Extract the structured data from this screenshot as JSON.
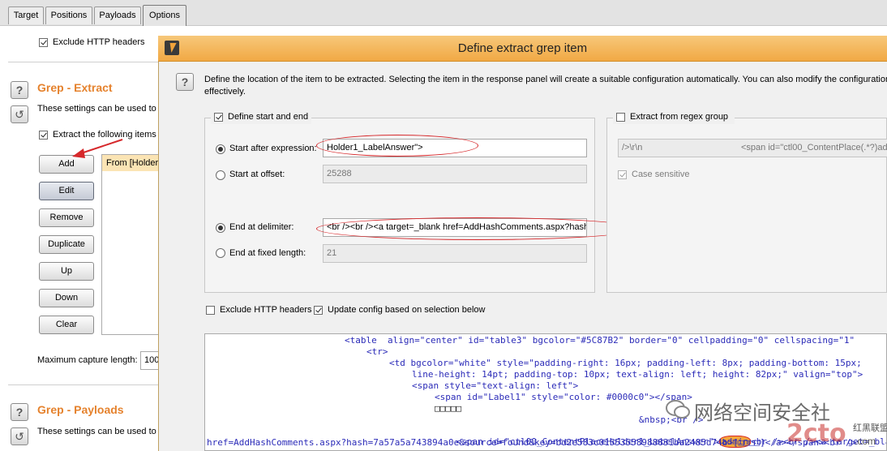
{
  "tabs": [
    {
      "label": "Target",
      "active": false
    },
    {
      "label": "Positions",
      "active": false
    },
    {
      "label": "Payloads",
      "active": false
    },
    {
      "label": "Options",
      "active": true
    }
  ],
  "left_panel": {
    "exclude_http_headers_label": "Exclude HTTP headers",
    "grep_extract": {
      "title": "Grep - Extract",
      "description": "These settings can be used to",
      "extract_following_label": "Extract the following items",
      "buttons": [
        "Add",
        "Edit",
        "Remove",
        "Duplicate",
        "Up",
        "Down",
        "Clear"
      ],
      "list_item": "From [Holder",
      "max_capture_label": "Maximum capture length:",
      "max_capture_value": "100"
    },
    "grep_payloads": {
      "title": "Grep - Payloads",
      "description": "These settings can be used to"
    }
  },
  "dialog": {
    "title": "Define extract grep item",
    "description": "Define the location of the item to be extracted. Selecting the item in the response panel will create a suitable configuration automatically. You can also modify the configuration m",
    "description_line2": "effectively.",
    "define_start_end_label": "Define start and end",
    "start_after_label": "Start after expression:",
    "start_after_value": "Holder1_LabelAnswer\">",
    "start_offset_label": "Start at offset:",
    "start_offset_value": "25288",
    "end_delimiter_label": "End at delimiter:",
    "end_delimiter_value": "<br /><br /><a target=_blank href=AddHashComments.aspx?hash",
    "end_fixed_label": "End at fixed length:",
    "end_fixed_value": "21",
    "regex_group_label": "Extract from regex group",
    "regex_value_left": "/>\\r\\n",
    "regex_value_right": "<span id=\"ctl00_ContentPlace(.*?)adm",
    "case_sensitive_label": "Case sensitive",
    "exclude_headers_label": "Exclude HTTP headers",
    "update_config_label": "Update config based on selection below"
  },
  "code_lines": [
    {
      "text": "<table  align=\"center\" id=\"table3\" bgcolor=\"#5C87B2\" border=\"0\" cellpadding=\"0\" cellspacing=\"1\""
    },
    {
      "text": "<tr>"
    },
    {
      "text": "<td bgcolor=\"white\" style=\"padding-right: 16px; padding-left: 8px; padding-bottom: 15px;"
    },
    {
      "text": "line-height: 14pt; padding-top: 10px; text-align: left; height: 82px;\" valign=\"top\">"
    },
    {
      "text": "<span style=\"text-align: left\">"
    },
    {
      "text": "<span id=\"Label1\" style=\"color: #0000c0\"></span>"
    },
    {
      "text": "□□□□□"
    },
    {
      "text": "&nbsp;<br />"
    },
    {
      "text": "<span id=\"ctl00_ContentPlaceHolder1_LabelAnswer\">"
    },
    {
      "text": "admin"
    },
    {
      "text": "<br /><br /><a target=_blank"
    },
    {
      "text": "href=AddHashComments.aspx?hash=7a57a5a743894a0e&source=found&key=bd2e583c01553558988831ba2485d74b>[□□□□]</a></span><br />"
    }
  ],
  "watermark": {
    "text": "网络空间安全社",
    "logo_text": "2cto",
    "logo_suffix": ".com",
    "small_text": "红黑联盟"
  }
}
